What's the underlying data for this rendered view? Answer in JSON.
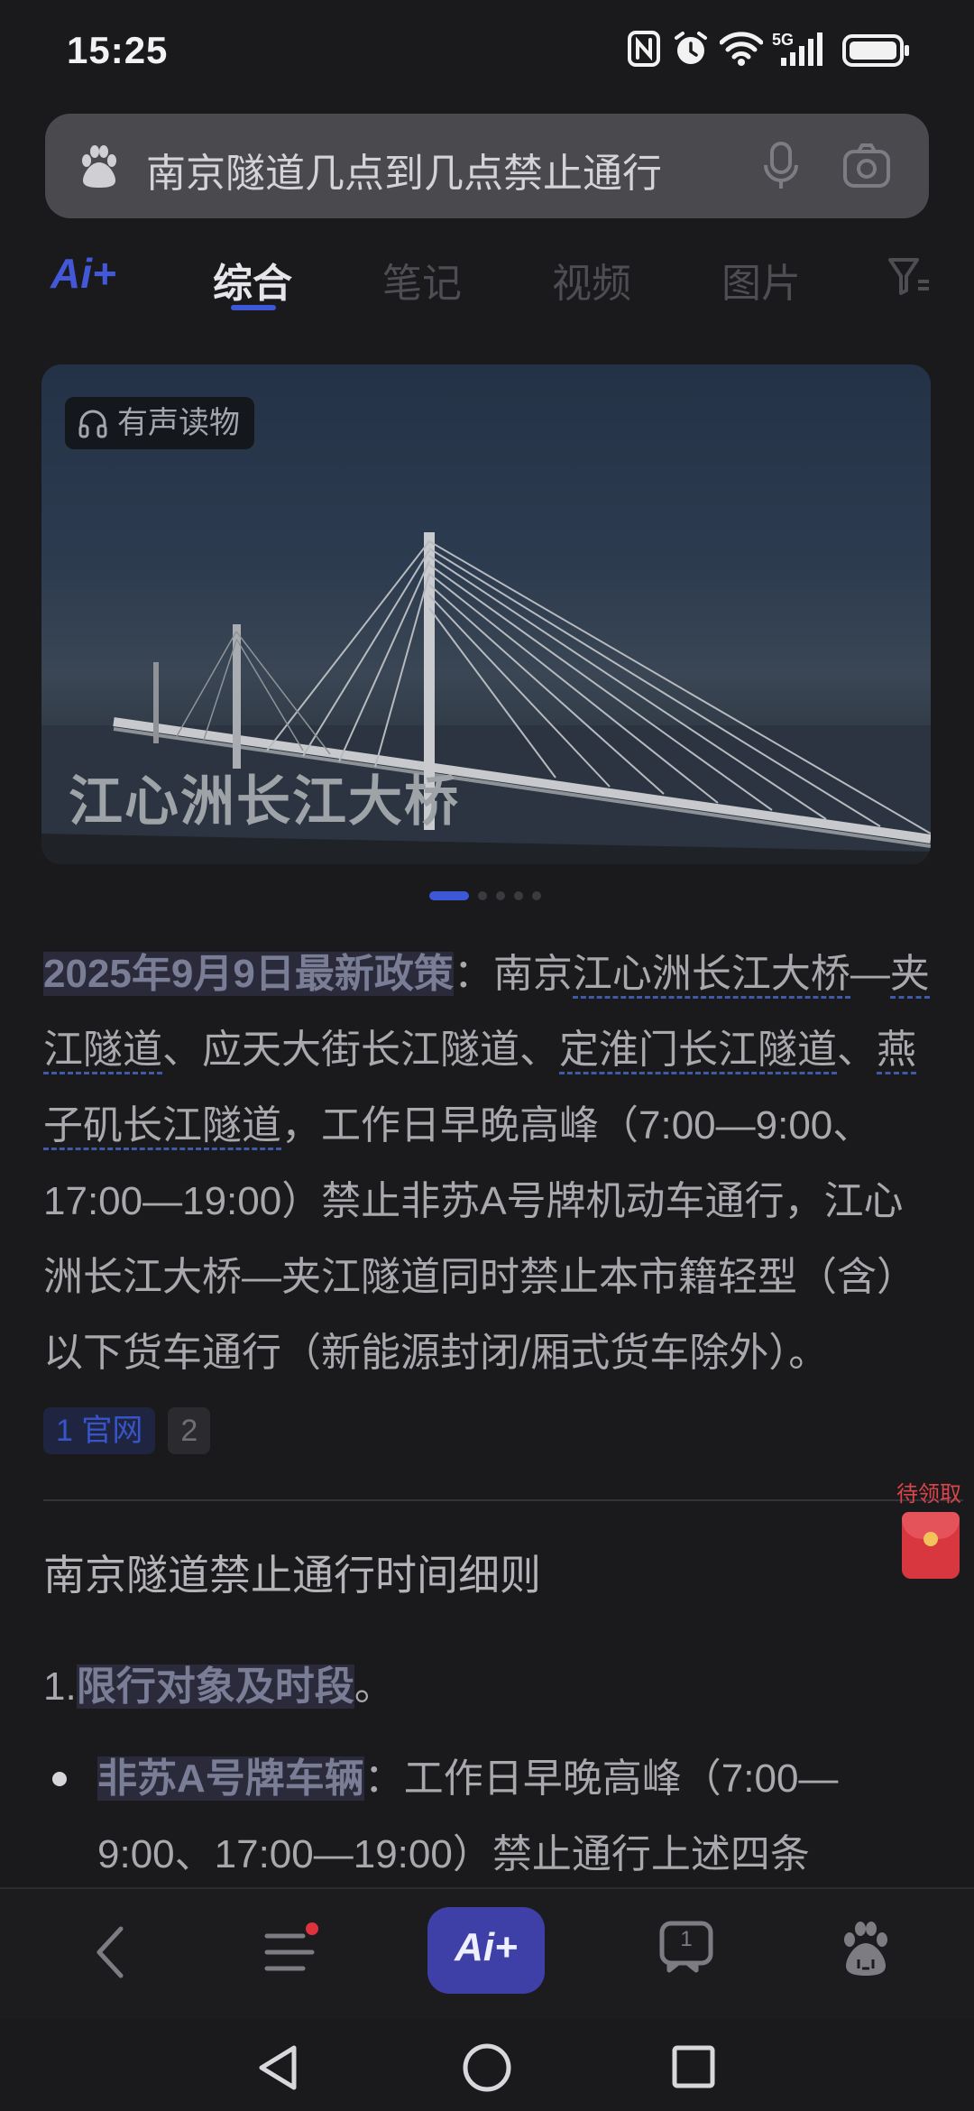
{
  "status": {
    "time": "15:25",
    "network": "5G",
    "icons": [
      "nfc-icon",
      "alarm-icon",
      "wifi-icon",
      "signal-5g-icon",
      "battery-icon"
    ]
  },
  "search": {
    "query": "南京隧道几点到几点禁止通行",
    "icons": [
      "baidu-paw-icon",
      "microphone-icon",
      "camera-icon"
    ]
  },
  "tabs": {
    "ai_label": "Ai+",
    "items": [
      "综合",
      "笔记",
      "视频",
      "图片"
    ],
    "active": "综合",
    "filter_icon": "filter-icon"
  },
  "hero": {
    "badge": "有声读物",
    "title": "江心洲长江大桥",
    "slide_count": 5,
    "active_slide": 1
  },
  "article": {
    "date_policy": "2025年9月9日最新政策",
    "colon": "：",
    "p1_a": "南京",
    "p1_link1": "江心洲长江大桥",
    "p1_b": "—",
    "p1_link2": "夹江隧道",
    "p1_c": "、应天大街长江隧道、",
    "p1_link3": "定淮门长江隧道",
    "p1_d": "、",
    "p1_link4": "燕子矶长江隧道",
    "p1_e": "，工作日早晚高峰（7:00—9:00、17:00—19:00）禁止非苏A号牌机动车通行，江心洲长江大桥—夹江隧道同时禁止本市籍轻型（含）以下货车通行（新能源封闭/厢式货车除外）。",
    "cite1_num": "1",
    "cite1_label": "官网",
    "cite2_num": "2",
    "section_title": "南京隧道禁止通行时间细则",
    "list1_num": "1.",
    "list1_title": "限行对象及时段",
    "list1_end": "。",
    "bullet1_title": "非苏A号牌车辆",
    "bullet1_colon": "：",
    "bullet1_text": "工作日早晚高峰（7:00—9:00、17:00—19:00）禁止通行上述四条"
  },
  "redpack": {
    "label": "待领取"
  },
  "bottom_nav": {
    "ai_label": "Ai+",
    "tabs_count": "1",
    "icons": [
      "back-icon",
      "menu-icon",
      "ai-plus-icon",
      "tabs-icon",
      "baidu-paw-icon"
    ],
    "has_notification_dot": true
  },
  "colors": {
    "accent": "#3c58d6",
    "ai_button": "#3f3fa8",
    "redpack": "#d8373f",
    "background": "#1a1a1c"
  }
}
